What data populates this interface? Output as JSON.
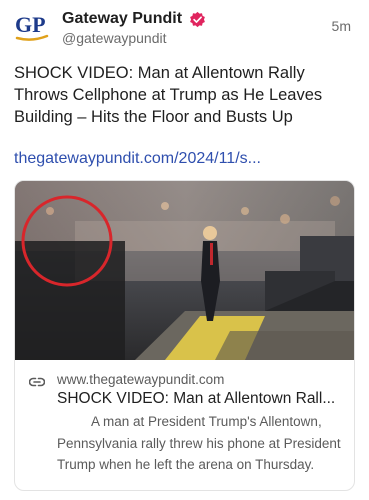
{
  "post": {
    "author_name": "Gateway Pundit",
    "author_handle": "@gatewaypundit",
    "avatar_text": "GP",
    "time": "5m",
    "text": "SHOCK VIDEO: Man at Allentown Rally Throws Cellphone at Trump as He Leaves Building – Hits the Floor and Busts Up",
    "link": "thegatewaypundit.com/2024/11/s..."
  },
  "card": {
    "domain": "www.thegatewaypundit.com",
    "title": "SHOCK VIDEO: Man at Allentown Rall...",
    "description": "A man at President Trump's Allentown, Pennsylvania rally threw his phone at President Trump when he left the arena on Thursday."
  },
  "colors": {
    "brand_blue": "#1d3a8a",
    "brand_gold": "#e0a11b",
    "verified": "#e0245e",
    "link": "#2f4fae"
  }
}
